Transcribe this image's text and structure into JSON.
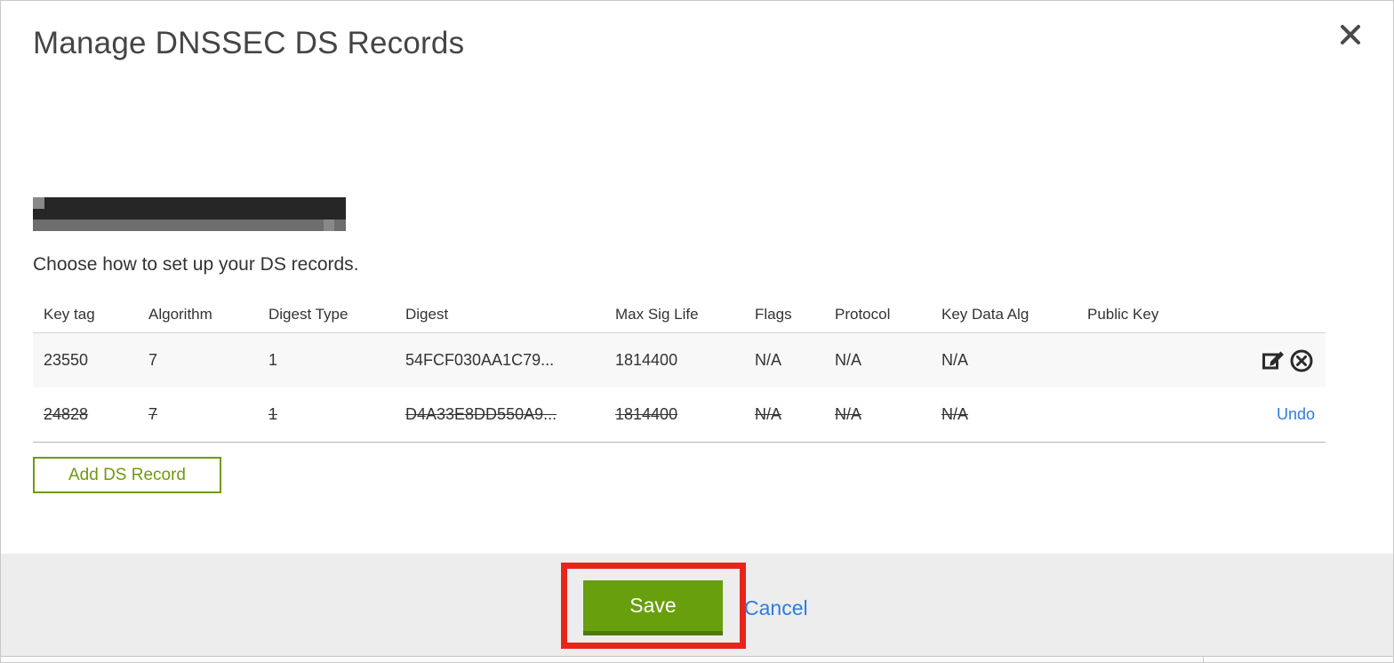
{
  "modal": {
    "title": "Manage DNSSEC DS Records",
    "domain": "(redacted)",
    "subtitle": "Choose how to set up your DS records."
  },
  "table": {
    "headers": {
      "key_tag": "Key tag",
      "algorithm": "Algorithm",
      "digest_type": "Digest Type",
      "digest": "Digest",
      "max_sig_life": "Max Sig Life",
      "flags": "Flags",
      "protocol": "Protocol",
      "key_data_alg": "Key Data Alg",
      "public_key": "Public Key"
    },
    "rows": [
      {
        "key_tag": "23550",
        "algorithm": "7",
        "digest_type": "1",
        "digest": "54FCF030AA1C79...",
        "max_sig_life": "1814400",
        "flags": "N/A",
        "protocol": "N/A",
        "key_data_alg": "N/A",
        "public_key": "",
        "state": "active"
      },
      {
        "key_tag": "24828",
        "algorithm": "7",
        "digest_type": "1",
        "digest": "D4A33E8DD550A9...",
        "max_sig_life": "1814400",
        "flags": "N/A",
        "protocol": "N/A",
        "key_data_alg": "N/A",
        "public_key": "",
        "state": "deleted",
        "undo_label": "Undo"
      }
    ]
  },
  "buttons": {
    "add_ds_record": "Add DS Record",
    "save": "Save",
    "cancel": "Cancel"
  },
  "colors": {
    "accent_green": "#6f9a0d",
    "save_green": "#689f0d",
    "save_green_dark": "#4e7a06",
    "link_blue": "#2f7ce0",
    "annotation_red": "#e8251c",
    "footer_gray": "#ededed"
  }
}
